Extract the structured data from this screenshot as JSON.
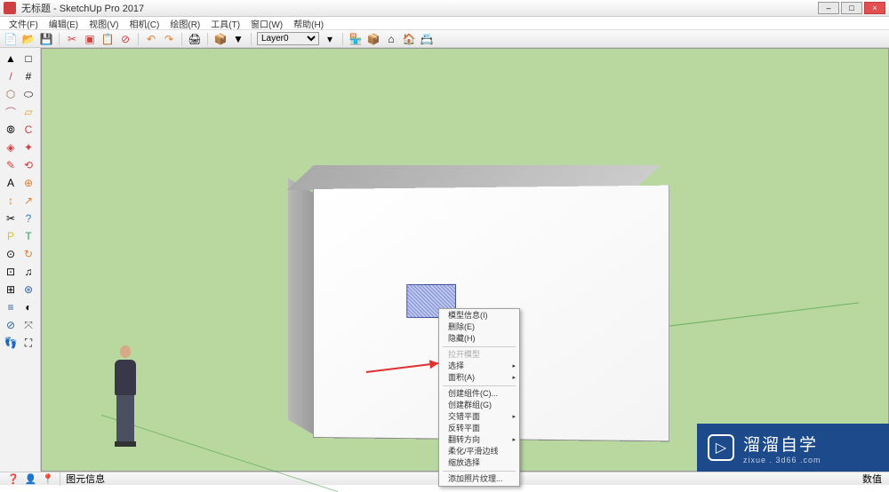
{
  "titlebar": {
    "title": "无标题 - SketchUp Pro 2017",
    "minimize": "–",
    "maximize": "□",
    "close": "×"
  },
  "menubar": {
    "items": [
      "文件(F)",
      "编辑(E)",
      "视图(V)",
      "相机(C)",
      "绘图(R)",
      "工具(T)",
      "窗口(W)",
      "帮助(H)"
    ]
  },
  "toolbar": {
    "layer_value": "Layer0",
    "icons": [
      "new",
      "open",
      "save",
      "cut",
      "copy",
      "paste",
      "delete",
      "undo",
      "redo",
      "print",
      "model"
    ]
  },
  "left_tools": {
    "glyphs": [
      "▲",
      "□",
      "/",
      "#",
      "⬡",
      "⬭",
      "⌒",
      "▱",
      "⦾",
      "C",
      "◈",
      "✦",
      "✎",
      "⟲",
      "A",
      "⊕",
      "↕",
      "↗",
      "✂",
      "?",
      "P",
      "T",
      "⊙",
      "↻",
      "⊡",
      "♫",
      "⊞",
      "⊛",
      "≡",
      "◐",
      "⊘",
      "⤧",
      "⌬",
      "☗",
      "👣",
      "⛶"
    ]
  },
  "context_menu": {
    "items": [
      {
        "label": "模型信息(I)",
        "type": "item"
      },
      {
        "label": "删除(E)",
        "type": "item"
      },
      {
        "label": "隐藏(H)",
        "type": "item"
      },
      {
        "type": "sep"
      },
      {
        "label": "拉开模型",
        "type": "item",
        "disabled": true
      },
      {
        "label": "选择",
        "type": "sub"
      },
      {
        "label": "面积(A)",
        "type": "sub"
      },
      {
        "type": "sep"
      },
      {
        "label": "创建组件(C)...",
        "type": "item"
      },
      {
        "label": "创建群组(G)",
        "type": "item"
      },
      {
        "label": "交错平面",
        "type": "sub"
      },
      {
        "label": "反转平面",
        "type": "item"
      },
      {
        "label": "翻转方向",
        "type": "sub"
      },
      {
        "label": "柔化/平滑边线",
        "type": "item"
      },
      {
        "label": "缩放选择",
        "type": "item"
      },
      {
        "type": "sep"
      },
      {
        "label": "添加照片纹理...",
        "type": "item"
      }
    ]
  },
  "statusbar": {
    "left_text": "图元信息",
    "right_label": "数值"
  },
  "watermark": {
    "main": "溜溜自学",
    "sub": "zixue . 3d66 .com"
  },
  "feet": "👣 👣"
}
